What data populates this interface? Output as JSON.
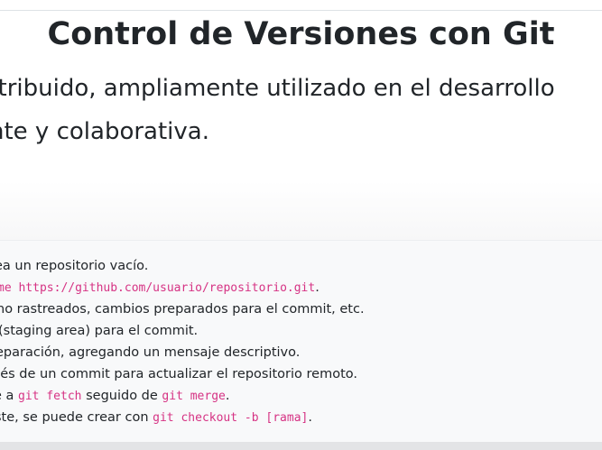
{
  "header": {
    "title": "Control de Versiones con Git"
  },
  "intro": {
    "line1": "stribuido, ampliamente utilizado en el desarrollo",
    "line2": "nte y colaborativa."
  },
  "commands": [
    {
      "text": "ea un repositorio vacío."
    },
    {
      "code": "me https://github.com/usuario/repositorio.git",
      "after": "."
    },
    {
      "text": " no rastreados, cambios preparados para el commit, etc."
    },
    {
      "text": "(staging area) para el commit."
    },
    {
      "text": "eparación, agregando un mensaje descriptivo."
    },
    {
      "text": "ués de un commit para actualizar el repositorio remoto."
    },
    {
      "before": "e a ",
      "code1": "git fetch",
      "mid": " seguido de ",
      "code2": "git merge",
      "after": "."
    },
    {
      "before": "ste, se puede crear con ",
      "code": "git checkout -b [rama]",
      "after": "."
    }
  ],
  "colors": {
    "text": "#212529",
    "code": "#d63384",
    "panel": "#f8f9fa"
  }
}
